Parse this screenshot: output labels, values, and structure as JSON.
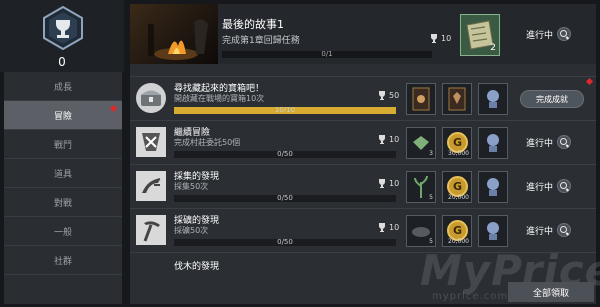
{
  "emblem": {
    "count": "0"
  },
  "sidebar": {
    "items": [
      {
        "label": "成長",
        "active": false
      },
      {
        "label": "冒險",
        "active": true,
        "new": true
      },
      {
        "label": "戰鬥",
        "active": false
      },
      {
        "label": "道具",
        "active": false
      },
      {
        "label": "對戰",
        "active": false
      },
      {
        "label": "一般",
        "active": false
      },
      {
        "label": "社群",
        "active": false
      }
    ]
  },
  "hero": {
    "title": "最後的故事1",
    "subtitle": "完成第1章回歸任務",
    "progress_text": "0/1",
    "progress": 0,
    "trophy": "10",
    "reward_count": "2",
    "status": "進行中"
  },
  "rows": [
    {
      "title": "尋找藏起來的寶箱吧！",
      "desc": "開啟藏在戰場的寶箱10次",
      "progress_text": "10/10",
      "progress": 1,
      "trophy": "50",
      "rewards": [
        {
          "icon": "card-icon",
          "count": ""
        },
        {
          "icon": "card-icon",
          "count": ""
        },
        {
          "icon": "figure-icon",
          "count": ""
        }
      ],
      "action": "完成成就"
    },
    {
      "title": "繼續冒險",
      "desc": "完成村莊委託50個",
      "progress_text": "0/50",
      "progress": 0,
      "trophy": "10",
      "rewards": [
        {
          "icon": "ore-icon",
          "count": "3"
        },
        {
          "icon": "gold-coin-icon",
          "count": "30,000"
        },
        {
          "icon": "figure-icon",
          "count": ""
        }
      ],
      "action": "進行中"
    },
    {
      "title": "採集的發現",
      "desc": "採集50次",
      "progress_text": "0/50",
      "progress": 0,
      "trophy": "10",
      "rewards": [
        {
          "icon": "herb-icon",
          "count": "5"
        },
        {
          "icon": "gold-coin-icon",
          "count": "20,000"
        },
        {
          "icon": "figure-icon",
          "count": ""
        }
      ],
      "action": "進行中"
    },
    {
      "title": "採礦的發現",
      "desc": "採礦50次",
      "progress_text": "0/50",
      "progress": 0,
      "trophy": "10",
      "rewards": [
        {
          "icon": "ore-icon",
          "count": "5"
        },
        {
          "icon": "gold-coin-icon",
          "count": "20,000"
        },
        {
          "icon": "figure-icon",
          "count": ""
        }
      ],
      "action": "進行中"
    },
    {
      "title": "伐木的發現",
      "desc": "",
      "progress_text": "",
      "progress": 0,
      "trophy": "",
      "rewards": [],
      "action": ""
    }
  ],
  "footer": {
    "claim_all": "全部領取"
  },
  "watermark": {
    "text": "MyPrice",
    "url": "myprice.com.tw"
  },
  "colors": {
    "accent": "#d8ac31",
    "alert": "#e0282a",
    "panel": "#2b2f34"
  }
}
